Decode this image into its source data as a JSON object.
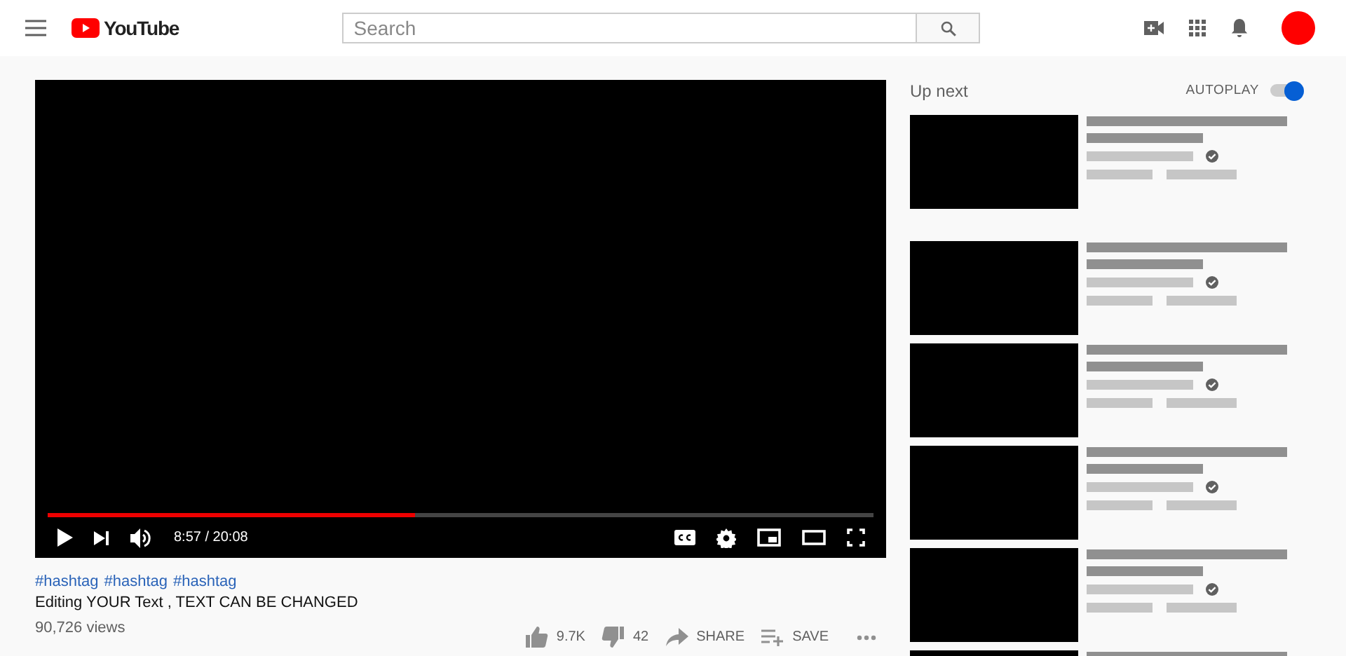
{
  "header": {
    "logo": "YouTube",
    "search": {
      "placeholder": "Search"
    }
  },
  "player": {
    "progress": {
      "level": 0.445
    },
    "time": "8:57 / 20:08"
  },
  "info": {
    "hashtags": [
      "#hashtag",
      "#hashtag",
      "#hashtag"
    ],
    "title": "Editing YOUR Text , TEXT CAN BE CHANGED",
    "views": "90,726 views",
    "actions": [
      {
        "kind": "like",
        "label": "9.7K"
      },
      {
        "kind": "dislike",
        "label": "42"
      },
      {
        "kind": "share",
        "label": "SHARE"
      },
      {
        "kind": "save",
        "label": "SAVE"
      },
      {
        "kind": "more"
      }
    ]
  },
  "sidebar": {
    "heading": "Up next",
    "autoplay": {
      "label": "AUTOPLAY",
      "on": true
    },
    "videos": [
      {
        "kind": "full",
        "verified": true
      },
      {
        "kind": "full",
        "verified": true
      },
      {
        "kind": "full",
        "verified": true
      },
      {
        "kind": "full",
        "verified": true
      },
      {
        "kind": "full",
        "verified": true
      },
      {
        "kind": "partial"
      }
    ]
  }
}
